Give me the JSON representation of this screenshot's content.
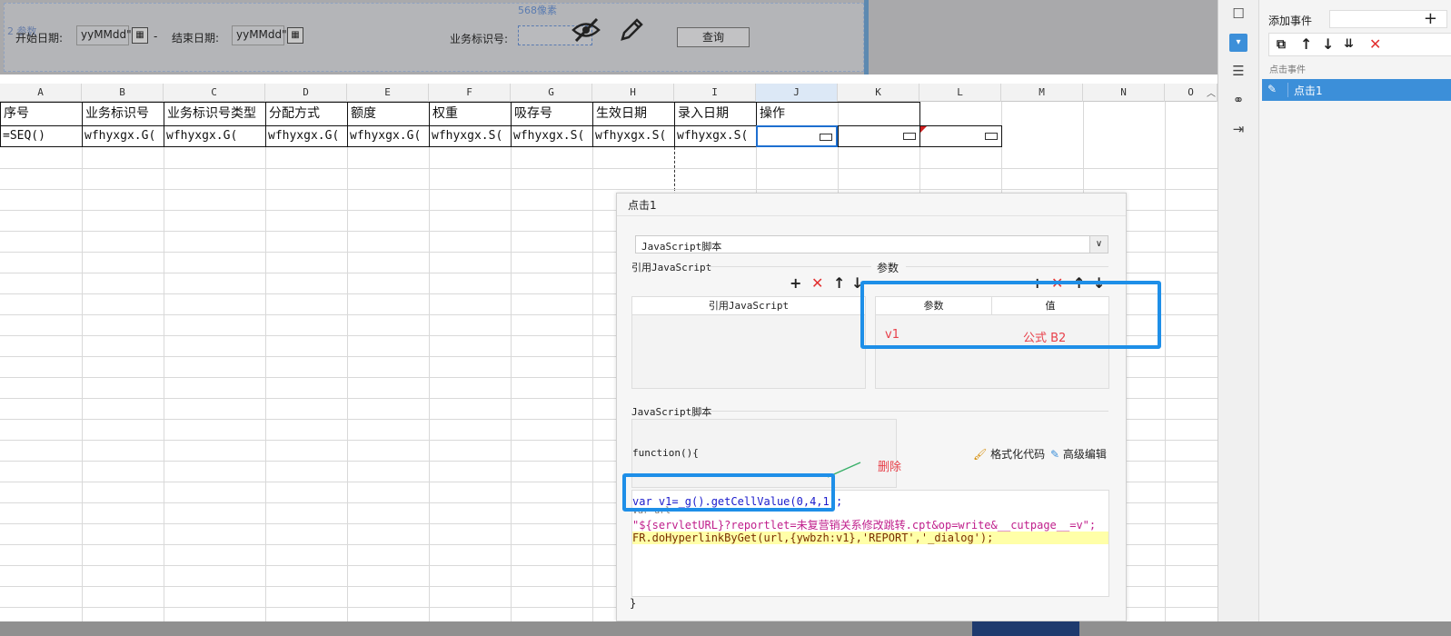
{
  "param_bar": {
    "ruler_text": "568像素",
    "overlap_text": "2 参数",
    "start_date_label": "开始日期:",
    "start_date_value": "yyMMdd\")",
    "dash": "-",
    "end_date_label": "结束日期:",
    "end_date_value": "yyMMdd\")",
    "biz_id_label": "业务标识号:",
    "query_button": "查询"
  },
  "sheet": {
    "columns": [
      "A",
      "B",
      "C",
      "D",
      "E",
      "F",
      "G",
      "H",
      "I",
      "J",
      "K",
      "L",
      "M",
      "N",
      "O"
    ],
    "header_row": [
      "序号",
      "业务标识号",
      "业务标识号类型",
      "分配方式",
      "额度",
      "权重",
      "吸存号",
      "生效日期",
      "录入日期",
      "操作"
    ],
    "data_row": [
      "=SEQ()",
      "wfhyxgx.G(",
      "wfhyxgx.G(",
      "wfhyxgx.G(",
      "wfhyxgx.G(",
      "wfhyxgx.S(",
      "wfhyxgx.S(",
      "wfhyxgx.S(",
      "wfhyxgx.S("
    ]
  },
  "right_panel": {
    "add_event_label": "添加事件",
    "add_icon": "+",
    "section_label": "点击事件",
    "event_item": "点击1"
  },
  "dialog": {
    "title": "点击1",
    "type_select": "JavaScript脚本",
    "ref_js_section": "引用JavaScript",
    "params_section": "参数",
    "ref_js_column": "引用JavaScript",
    "params_col_param": "参数",
    "params_col_value": "值",
    "param_row_name": "v1",
    "param_row_value": "公式 B2",
    "js_script_section": "JavaScript脚本",
    "function_header": "function(){",
    "format_code": "格式化代码",
    "advanced_edit": "高级编辑",
    "annotation_delete": "删除",
    "code_line1": "var v1=_g().getCellValue(0,4,1);",
    "code_line2_partial": "var url",
    "code_line3": "\"${servletURL}?reportlet=未复营销关系修改跳转.cpt&op=write&__cutpage__=v\";",
    "code_line4": "FR.doHyperlinkByGet(url,{ywbzh:v1},'REPORT','_dialog');",
    "function_footer": "}"
  },
  "colors": {
    "accent_blue": "#1e8fe8",
    "annotation_red": "#e8404a",
    "selected_item_bg": "#3c8fd9",
    "code_highlight": "#ffffa8"
  }
}
